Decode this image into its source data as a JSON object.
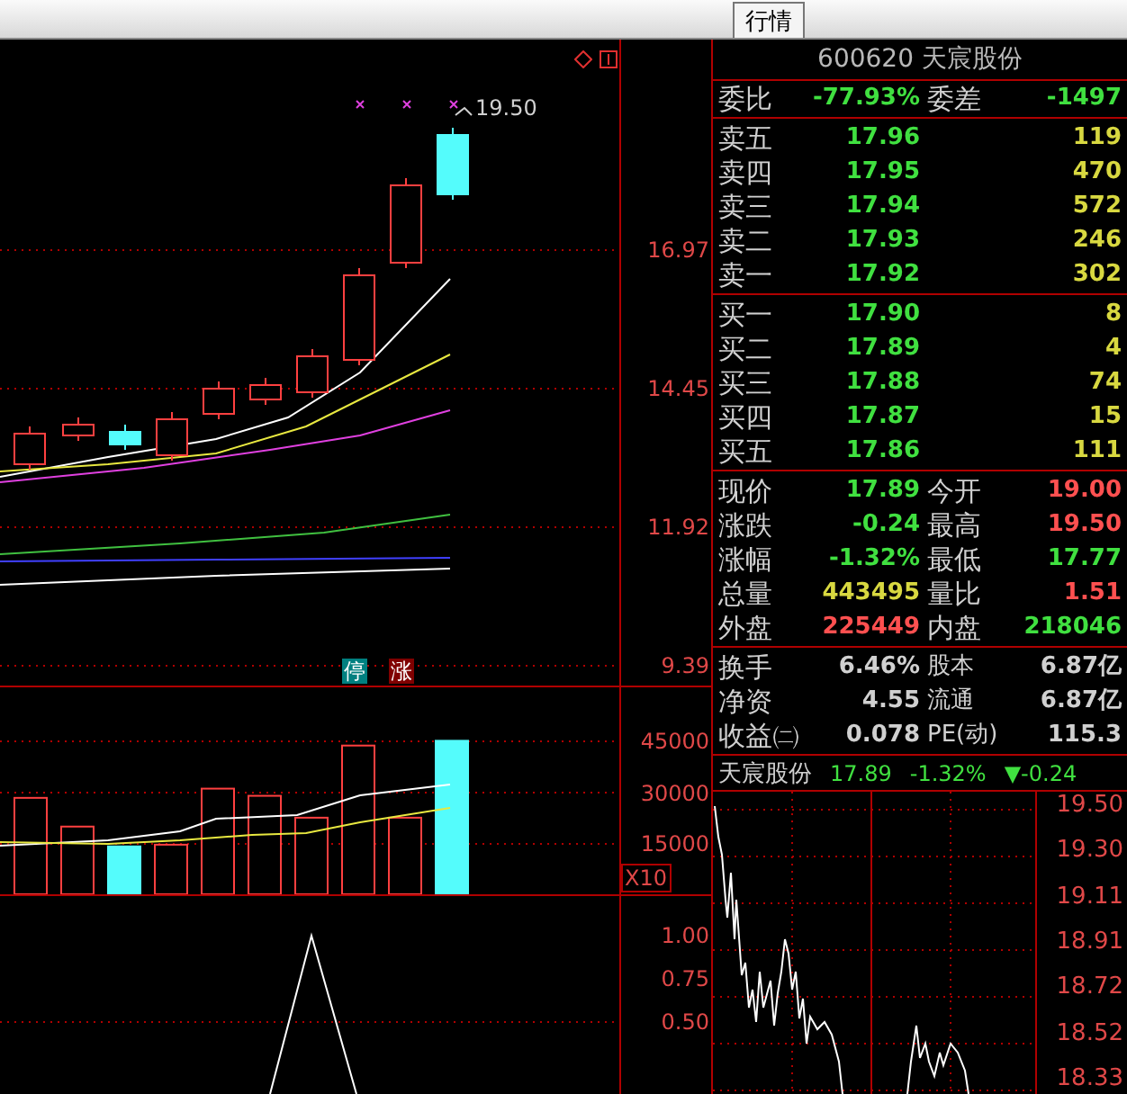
{
  "toolbar": {
    "tabs": [
      {
        "label": "行情",
        "selected": true
      }
    ]
  },
  "kline": {
    "price_axis": [
      "16.97",
      "14.45",
      "11.92",
      "9.39"
    ],
    "high_label": "19.50",
    "markers": [
      {
        "label": "停",
        "kind": "halt"
      },
      {
        "label": "涨",
        "kind": "rise"
      }
    ]
  },
  "volume": {
    "axis": [
      "45000",
      "30000",
      "15000"
    ],
    "scale": "X10"
  },
  "indicator": {
    "axis": [
      "1.00",
      "0.75",
      "0.50"
    ]
  },
  "quote": {
    "title": "600620 天宸股份",
    "ratio": [
      {
        "label": "委比",
        "value": "-77.93%",
        "color": "#40e040"
      },
      {
        "label": "委差",
        "value": "-1497",
        "color": "#40e040"
      }
    ],
    "asks": [
      {
        "label": "卖五",
        "price": "17.96",
        "volume": "119"
      },
      {
        "label": "卖四",
        "price": "17.95",
        "volume": "470"
      },
      {
        "label": "卖三",
        "price": "17.94",
        "volume": "572"
      },
      {
        "label": "卖二",
        "price": "17.93",
        "volume": "246"
      },
      {
        "label": "卖一",
        "price": "17.92",
        "volume": "302"
      }
    ],
    "bids": [
      {
        "label": "买一",
        "price": "17.90",
        "volume": "8"
      },
      {
        "label": "买二",
        "price": "17.89",
        "volume": "4"
      },
      {
        "label": "买三",
        "price": "17.88",
        "volume": "74"
      },
      {
        "label": "买四",
        "price": "17.87",
        "volume": "15"
      },
      {
        "label": "买五",
        "price": "17.86",
        "volume": "111"
      }
    ],
    "stats": [
      [
        {
          "label": "现价",
          "value": "17.89",
          "color": "#40e040"
        },
        {
          "label": "今开",
          "value": "19.00",
          "color": "#ff5050"
        }
      ],
      [
        {
          "label": "涨跌",
          "value": "-0.24",
          "color": "#40e040"
        },
        {
          "label": "最高",
          "value": "19.50",
          "color": "#ff5050"
        }
      ],
      [
        {
          "label": "涨幅",
          "value": "-1.32%",
          "color": "#40e040"
        },
        {
          "label": "最低",
          "value": "17.77",
          "color": "#40e040"
        }
      ],
      [
        {
          "label": "总量",
          "value": "443495",
          "color": "#d8d840"
        },
        {
          "label": "量比",
          "value": "1.51",
          "color": "#ff5050"
        }
      ],
      [
        {
          "label": "外盘",
          "value": "225449",
          "color": "#ff5050"
        },
        {
          "label": "内盘",
          "value": "218046",
          "color": "#40e040"
        }
      ]
    ],
    "finance": [
      [
        {
          "label": "换手",
          "value": "6.46%",
          "color": "#d0d0d0"
        },
        {
          "label": "股本",
          "value": "6.87亿",
          "color": "#d0d0d0"
        }
      ],
      [
        {
          "label": "净资",
          "value": "4.55",
          "color": "#d0d0d0"
        },
        {
          "label": "流通",
          "value": "6.87亿",
          "color": "#d0d0d0"
        }
      ],
      [
        {
          "label": "收益㈡",
          "value": "0.078",
          "color": "#d0d0d0"
        },
        {
          "label": "PE(动)",
          "value": "115.3",
          "color": "#d0d0d0"
        }
      ]
    ]
  },
  "intraday": {
    "name": "天宸股份",
    "price": "17.89",
    "change_pct": "-1.32%",
    "change": "▼-0.24",
    "color": "#40e040",
    "price_axis": [
      "19.50",
      "19.30",
      "19.11",
      "18.91",
      "18.72",
      "18.52",
      "18.33"
    ]
  }
}
